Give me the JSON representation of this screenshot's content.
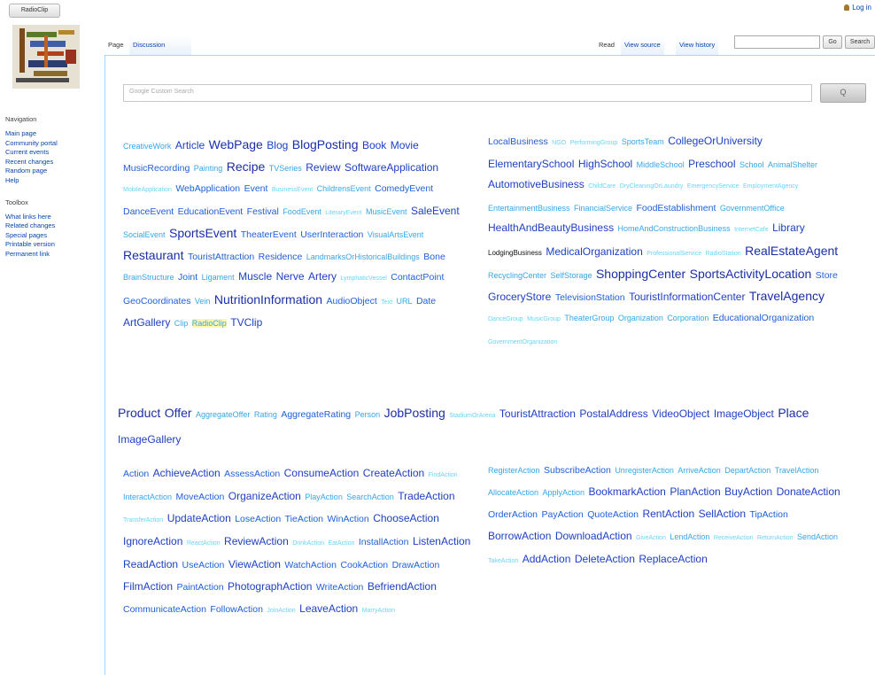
{
  "header": {
    "site_button": "RadioClip",
    "login": "Log in"
  },
  "tabs": {
    "page": "Page",
    "discussion": "Discussion",
    "read": "Read",
    "view_source": "View source",
    "view_history": "View history"
  },
  "search": {
    "go": "Go",
    "search": "Search",
    "custom_placeholder": "Google Custom Search",
    "custom_button": "Q"
  },
  "navigation": {
    "heading": "Navigation",
    "items": [
      "Main page",
      "Community portal",
      "Current events",
      "Recent changes",
      "Random page",
      "Help"
    ]
  },
  "toolbox": {
    "heading": "Toolbox",
    "items": [
      "What links here",
      "Related changes",
      "Special pages",
      "Printable version",
      "Permanent link"
    ]
  },
  "clouds": {
    "creative": [
      [
        "CreativeWork",
        2
      ],
      [
        "Article",
        4
      ],
      [
        "WebPage",
        5
      ],
      [
        "Blog",
        4
      ],
      [
        "BlogPosting",
        5
      ],
      [
        "Book",
        4
      ],
      [
        "Movie",
        4
      ],
      [
        "MusicRecording",
        3
      ],
      [
        "Painting",
        2
      ],
      [
        "Recipe",
        5
      ],
      [
        "TVSeries",
        2
      ],
      [
        "Review",
        4
      ],
      [
        "SoftwareApplication",
        4
      ],
      [
        "MobileApplication",
        1
      ],
      [
        "WebApplication",
        3
      ],
      [
        "Event",
        3
      ],
      [
        "BusinessEvent",
        1
      ],
      [
        "ChildrensEvent",
        2
      ],
      [
        "ComedyEvent",
        3
      ],
      [
        "DanceEvent",
        3
      ],
      [
        "EducationEvent",
        3
      ],
      [
        "Festival",
        3
      ],
      [
        "FoodEvent",
        2
      ],
      [
        "LiteraryEvent",
        1
      ],
      [
        "MusicEvent",
        2
      ],
      [
        "SaleEvent",
        4
      ],
      [
        "SocialEvent",
        2
      ],
      [
        "SportsEvent",
        5
      ],
      [
        "TheaterEvent",
        3
      ],
      [
        "UserInteraction",
        3
      ],
      [
        "VisualArtsEvent",
        2
      ],
      [
        "Restaurant",
        5
      ],
      [
        "TouristAttraction",
        3
      ],
      [
        "Residence",
        3
      ],
      [
        "LandmarksOrHistoricalBuildings",
        2
      ],
      [
        "Bone",
        3
      ],
      [
        "BrainStructure",
        2
      ],
      [
        "Joint",
        3
      ],
      [
        "Ligament",
        2
      ],
      [
        "Muscle",
        4
      ],
      [
        "Nerve",
        4
      ],
      [
        "Artery",
        4
      ],
      [
        "LymphaticVessel",
        1
      ],
      [
        "ContactPoint",
        3
      ],
      [
        "GeoCoordinates",
        3
      ],
      [
        "Vein",
        2
      ],
      [
        "NutritionInformation",
        5
      ],
      [
        "AudioObject",
        3
      ],
      [
        "Text",
        1
      ],
      [
        "URL",
        2
      ],
      [
        "Date",
        3
      ],
      [
        "ArtGallery",
        4
      ],
      [
        "Clip",
        2
      ],
      [
        "RadioClip",
        2
      ],
      [
        "TVClip",
        4
      ]
    ],
    "business": [
      [
        "LocalBusiness",
        3
      ],
      [
        "NGO",
        1
      ],
      [
        "PerformingGroup",
        1
      ],
      [
        "SportsTeam",
        2
      ],
      [
        "CollegeOrUniversity",
        4
      ],
      [
        "ElementarySchool",
        4
      ],
      [
        "HighSchool",
        4
      ],
      [
        "MiddleSchool",
        2
      ],
      [
        "Preschool",
        4
      ],
      [
        "School",
        2
      ],
      [
        "AnimalShelter",
        2
      ],
      [
        "AutomotiveBusiness",
        4
      ],
      [
        "ChildCare",
        1
      ],
      [
        "DryCleaningOrLaundry",
        1
      ],
      [
        "EmergencyService",
        1
      ],
      [
        "EmploymentAgency",
        1
      ],
      [
        "EntertainmentBusiness",
        2
      ],
      [
        "FinancialService",
        2
      ],
      [
        "FoodEstablishment",
        3
      ],
      [
        "GovernmentOffice",
        2
      ],
      [
        "HealthAndBeautyBusiness",
        4
      ],
      [
        "HomeAndConstructionBusiness",
        2
      ],
      [
        "InternetCafe",
        1
      ],
      [
        "Library",
        4
      ],
      [
        "LodgingBusiness",
        6
      ],
      [
        "MedicalOrganization",
        4
      ],
      [
        "ProfessionalService",
        1
      ],
      [
        "RadioStation",
        1
      ],
      [
        "RealEstateAgent",
        5
      ],
      [
        "RecyclingCenter",
        2
      ],
      [
        "SelfStorage",
        2
      ],
      [
        "ShoppingCenter",
        5
      ],
      [
        "SportsActivityLocation",
        5
      ],
      [
        "Store",
        3
      ],
      [
        "GroceryStore",
        4
      ],
      [
        "TelevisionStation",
        3
      ],
      [
        "TouristInformationCenter",
        4
      ],
      [
        "TravelAgency",
        5
      ],
      [
        "DanceGroup",
        1
      ],
      [
        "MusicGroup",
        1
      ],
      [
        "TheaterGroup",
        2
      ],
      [
        "Organization",
        2
      ],
      [
        "Corporation",
        2
      ],
      [
        "EducationalOrganization",
        3
      ],
      [
        "GovernmentOrganization",
        1
      ]
    ],
    "commerce": [
      [
        "Product",
        5
      ],
      [
        "Offer",
        5
      ],
      [
        "AggregateOffer",
        2
      ],
      [
        "Rating",
        2
      ],
      [
        "AggregateRating",
        3
      ],
      [
        "Person",
        2
      ],
      [
        "JobPosting",
        5
      ],
      [
        "StadiumOrArena",
        1
      ],
      [
        "TouristAttraction",
        4
      ],
      [
        "PostalAddress",
        4
      ],
      [
        "VideoObject",
        4
      ],
      [
        "ImageObject",
        4
      ],
      [
        "Place",
        5
      ],
      [
        "ImageGallery",
        4
      ]
    ],
    "actions_left": [
      [
        "Action",
        3
      ],
      [
        "AchieveAction",
        4
      ],
      [
        "AssessAction",
        3
      ],
      [
        "ConsumeAction",
        4
      ],
      [
        "CreateAction",
        4
      ],
      [
        "FindAction",
        1
      ],
      [
        "InteractAction",
        2
      ],
      [
        "MoveAction",
        3
      ],
      [
        "OrganizeAction",
        4
      ],
      [
        "PlayAction",
        2
      ],
      [
        "SearchAction",
        2
      ],
      [
        "TradeAction",
        4
      ],
      [
        "TransferAction",
        1
      ],
      [
        "UpdateAction",
        4
      ],
      [
        "LoseAction",
        3
      ],
      [
        "TieAction",
        3
      ],
      [
        "WinAction",
        3
      ],
      [
        "ChooseAction",
        4
      ],
      [
        "IgnoreAction",
        4
      ],
      [
        "ReactAction",
        1
      ],
      [
        "ReviewAction",
        4
      ],
      [
        "DrinkAction",
        1
      ],
      [
        "EatAction",
        1
      ],
      [
        "InstallAction",
        3
      ],
      [
        "ListenAction",
        4
      ],
      [
        "ReadAction",
        4
      ],
      [
        "UseAction",
        3
      ],
      [
        "ViewAction",
        4
      ],
      [
        "WatchAction",
        3
      ],
      [
        "CookAction",
        3
      ],
      [
        "DrawAction",
        3
      ],
      [
        "FilmAction",
        4
      ],
      [
        "PaintAction",
        3
      ],
      [
        "PhotographAction",
        4
      ],
      [
        "WriteAction",
        3
      ],
      [
        "BefriendAction",
        4
      ],
      [
        "CommunicateAction",
        3
      ],
      [
        "FollowAction",
        3
      ],
      [
        "JoinAction",
        1
      ],
      [
        "LeaveAction",
        4
      ],
      [
        "MarryAction",
        1
      ]
    ],
    "actions_right": [
      [
        "RegisterAction",
        2
      ],
      [
        "SubscribeAction",
        3
      ],
      [
        "UnregisterAction",
        2
      ],
      [
        "ArriveAction",
        2
      ],
      [
        "DepartAction",
        2
      ],
      [
        "TravelAction",
        2
      ],
      [
        "AllocateAction",
        2
      ],
      [
        "ApplyAction",
        2
      ],
      [
        "BookmarkAction",
        4
      ],
      [
        "PlanAction",
        4
      ],
      [
        "BuyAction",
        4
      ],
      [
        "DonateAction",
        4
      ],
      [
        "OrderAction",
        3
      ],
      [
        "PayAction",
        3
      ],
      [
        "QuoteAction",
        3
      ],
      [
        "RentAction",
        4
      ],
      [
        "SellAction",
        4
      ],
      [
        "TipAction",
        3
      ],
      [
        "BorrowAction",
        4
      ],
      [
        "DownloadAction",
        4
      ],
      [
        "GiveAction",
        1
      ],
      [
        "LendAction",
        2
      ],
      [
        "ReceiveAction",
        1
      ],
      [
        "ReturnAction",
        1
      ],
      [
        "SendAction",
        2
      ],
      [
        "TakeAction",
        1
      ],
      [
        "AddAction",
        4
      ],
      [
        "DeleteAction",
        4
      ],
      [
        "ReplaceAction",
        4
      ]
    ]
  }
}
